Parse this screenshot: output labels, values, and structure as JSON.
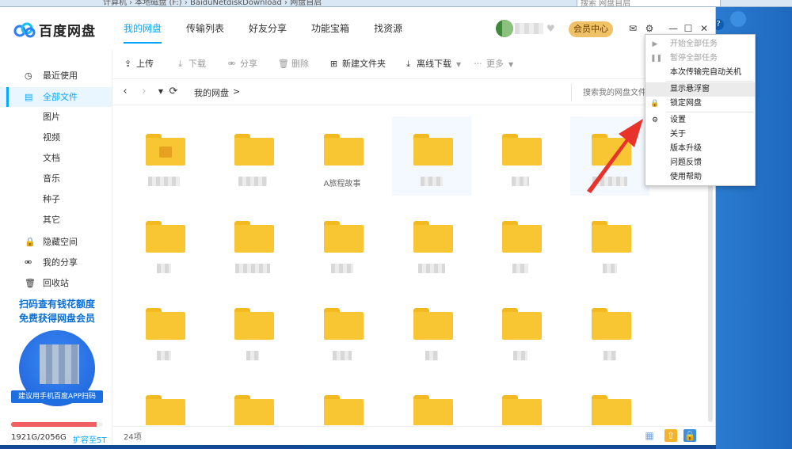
{
  "explorer": {
    "path": "计算机 › 本地磁盘 (F:) › BaiduNetdiskDownload › 网盘自启",
    "search_placeholder": "搜索 网盘自启"
  },
  "app": {
    "logo_text": "百度网盘",
    "nav_tabs": [
      {
        "label": "我的网盘",
        "active": true
      },
      {
        "label": "传输列表",
        "active": false
      },
      {
        "label": "好友分享",
        "active": false
      },
      {
        "label": "功能宝箱",
        "active": false
      },
      {
        "label": "找资源",
        "active": false
      }
    ],
    "vip_button": "会员中心",
    "colors": {
      "accent": "#06a7ff",
      "vip": "#f0c267",
      "folder": "#f8c533",
      "quota": "#f06060",
      "arrow": "#e8332a"
    }
  },
  "sidebar": {
    "items": [
      {
        "label": "最近使用",
        "icon": "clock-icon",
        "active": false,
        "sub": false
      },
      {
        "label": "全部文件",
        "icon": "document-icon",
        "active": true,
        "sub": false
      },
      {
        "label": "图片",
        "icon": "",
        "active": false,
        "sub": true
      },
      {
        "label": "视频",
        "icon": "",
        "active": false,
        "sub": true
      },
      {
        "label": "文档",
        "icon": "",
        "active": false,
        "sub": true
      },
      {
        "label": "音乐",
        "icon": "",
        "active": false,
        "sub": true
      },
      {
        "label": "种子",
        "icon": "",
        "active": false,
        "sub": true
      },
      {
        "label": "其它",
        "icon": "",
        "active": false,
        "sub": true
      },
      {
        "label": "隐藏空间",
        "icon": "lock-icon",
        "active": false,
        "sub": false
      },
      {
        "label": "我的分享",
        "icon": "share-icon",
        "active": false,
        "sub": false
      },
      {
        "label": "回收站",
        "icon": "trash-icon",
        "active": false,
        "sub": false
      }
    ],
    "promo_line1": "扫码查有钱花额度",
    "promo_line2": "免费获得网盘会员",
    "qr_caption": "建议用手机百度APP扫码",
    "quota_text": "1921G/2056G",
    "quota_fraction": 0.934,
    "expand_link": "扩容至5T"
  },
  "toolbar": {
    "upload": "上传",
    "download": "下载",
    "share": "分享",
    "delete": "删除",
    "new_folder": "新建文件夹",
    "offline_download": "离线下载",
    "more": "更多"
  },
  "pathbar": {
    "crumb": "我的网盘",
    "separator": ">",
    "search_placeholder": "搜索我的网盘文件"
  },
  "files": {
    "count_label": "24项",
    "items": [
      {
        "name": "",
        "locked": true,
        "selected": false
      },
      {
        "name": "",
        "locked": false,
        "selected": false
      },
      {
        "name": "A旅程故事",
        "locked": false,
        "selected": false
      },
      {
        "name": "",
        "locked": false,
        "selected": true
      },
      {
        "name": "",
        "locked": false,
        "selected": false
      },
      {
        "name": "",
        "locked": false,
        "selected": true
      },
      {
        "name": "",
        "locked": false,
        "selected": false
      },
      {
        "name": "",
        "locked": false,
        "selected": false
      },
      {
        "name": "",
        "locked": false,
        "selected": false
      },
      {
        "name": "",
        "locked": false,
        "selected": false
      },
      {
        "name": "",
        "locked": false,
        "selected": false
      },
      {
        "name": "",
        "locked": false,
        "selected": false
      },
      {
        "name": "",
        "locked": false,
        "selected": false
      },
      {
        "name": "",
        "locked": false,
        "selected": false
      },
      {
        "name": "",
        "locked": false,
        "selected": false
      },
      {
        "name": "",
        "locked": false,
        "selected": false
      },
      {
        "name": "",
        "locked": false,
        "selected": false
      },
      {
        "name": "",
        "locked": false,
        "selected": false
      },
      {
        "name": "",
        "locked": false,
        "selected": false
      },
      {
        "name": "",
        "locked": false,
        "selected": false
      },
      {
        "name": "",
        "locked": false,
        "selected": false
      },
      {
        "name": "",
        "locked": false,
        "selected": false
      },
      {
        "name": "",
        "locked": false,
        "selected": false
      },
      {
        "name": "",
        "locked": false,
        "selected": false
      }
    ]
  },
  "menu": {
    "items": [
      {
        "label": "开始全部任务",
        "icon": "play-icon",
        "disabled": true,
        "highlight": false
      },
      {
        "label": "暂停全部任务",
        "icon": "pause-icon",
        "disabled": true,
        "highlight": false
      },
      {
        "label": "本次传输完自动关机",
        "icon": "",
        "disabled": false,
        "highlight": false
      },
      {
        "label": "显示悬浮窗",
        "icon": "",
        "disabled": false,
        "highlight": true
      },
      {
        "label": "锁定网盘",
        "icon": "lock-icon",
        "disabled": false,
        "highlight": false
      },
      {
        "label": "设置",
        "icon": "gear-icon",
        "disabled": false,
        "highlight": false
      },
      {
        "label": "关于",
        "icon": "",
        "disabled": false,
        "highlight": false
      },
      {
        "label": "版本升级",
        "icon": "",
        "disabled": false,
        "highlight": false
      },
      {
        "label": "问题反馈",
        "icon": "",
        "disabled": false,
        "highlight": false
      },
      {
        "label": "使用帮助",
        "icon": "",
        "disabled": false,
        "highlight": false
      }
    ]
  }
}
